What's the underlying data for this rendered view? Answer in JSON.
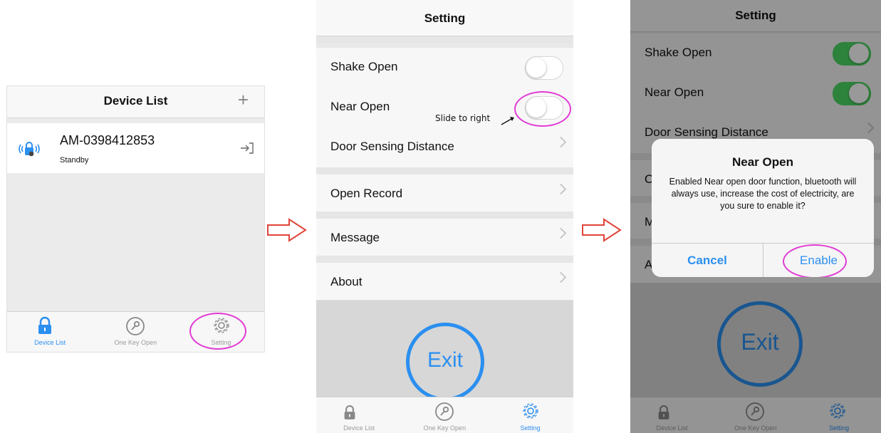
{
  "screen1": {
    "title": "Device List",
    "add_icon": "plus-icon",
    "device": {
      "name": "AM-0398412853",
      "status": "Standby",
      "icon": "lock-bluetooth-icon",
      "action_icon": "login-arrow-icon"
    },
    "tabs": [
      {
        "label": "Device List",
        "icon": "lock-icon",
        "active": true
      },
      {
        "label": "One Key Open",
        "icon": "key-icon",
        "active": false
      },
      {
        "label": "Setting",
        "icon": "gear-icon",
        "active": false
      }
    ]
  },
  "screen2": {
    "title": "Setting",
    "rows": [
      {
        "label": "Shake Open",
        "type": "toggle",
        "on": false
      },
      {
        "label": "Near Open",
        "type": "toggle",
        "on": false
      },
      {
        "label": "Door Sensing Distance",
        "type": "chevron"
      },
      {
        "label": "Open Record",
        "type": "chevron"
      },
      {
        "label": "Message",
        "type": "chevron"
      },
      {
        "label": "About",
        "type": "chevron"
      }
    ],
    "annotation": "Slide to right",
    "exit_label": "Exit",
    "tabs": [
      {
        "label": "Device List",
        "icon": "lock-icon",
        "active": false
      },
      {
        "label": "One Key Open",
        "icon": "key-icon",
        "active": false
      },
      {
        "label": "Setting",
        "icon": "gear-icon",
        "active": true
      }
    ]
  },
  "screen3": {
    "title": "Setting",
    "rows": [
      {
        "label": "Shake Open",
        "on": true
      },
      {
        "label": "Near Open",
        "on": true
      },
      {
        "label": "Door Sensing Distance"
      }
    ],
    "hidden_initials": [
      "O",
      "M",
      "A"
    ],
    "dialog": {
      "title": "Near Open",
      "message": "Enabled Near open door function, bluetooth will always use, increase the cost of electricity, are you sure to enable it?",
      "cancel": "Cancel",
      "enable": "Enable"
    },
    "exit_label": "Exit",
    "tabs": [
      {
        "label": "Device List",
        "icon": "lock-icon",
        "active": false
      },
      {
        "label": "One Key Open",
        "icon": "key-icon",
        "active": false
      },
      {
        "label": "Setting",
        "icon": "gear-icon",
        "active": true
      }
    ]
  },
  "colors": {
    "accent": "#2b8ff0",
    "toggle_on": "#4cd964",
    "highlight": "#e23bd5",
    "flow_arrow": "#e0453a"
  }
}
